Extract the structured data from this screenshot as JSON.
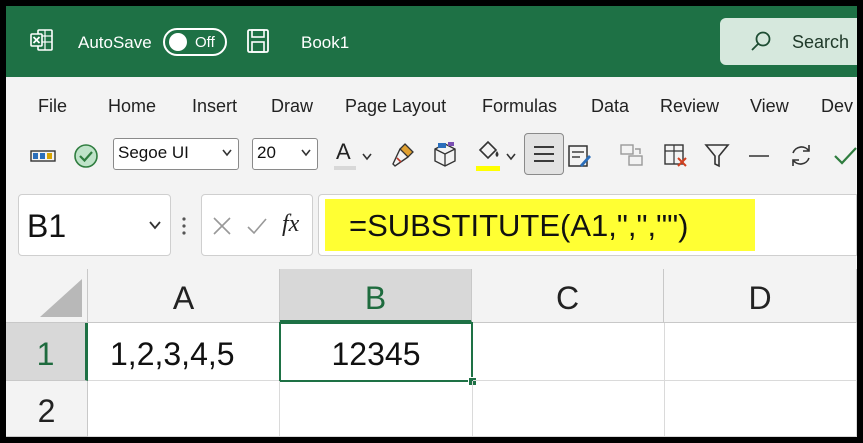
{
  "titlebar": {
    "autosave_label": "AutoSave",
    "autosave_state": "Off",
    "document_title": "Book1",
    "search_label": "Search"
  },
  "menu": {
    "items": [
      "File",
      "Home",
      "Insert",
      "Draw",
      "Page Layout",
      "Formulas",
      "Data",
      "Review",
      "View",
      "Dev"
    ]
  },
  "toolbar": {
    "font_name": "Segoe UI",
    "font_size": "20",
    "font_color_glyph": "A"
  },
  "formula_bar": {
    "name_box": "B1",
    "fx_label": "fx",
    "formula": "=SUBSTITUTE(A1,\",\",\"\")"
  },
  "sheet": {
    "columns": [
      "A",
      "B",
      "C",
      "D"
    ],
    "rows": [
      "1",
      "2"
    ],
    "cells": {
      "A1": "1,2,3,4,5",
      "B1": "12345"
    }
  },
  "colors": {
    "brand_green": "#1e7145",
    "formula_highlight": "#ffff33"
  },
  "icons": [
    "excel-icon",
    "save-icon",
    "search-icon",
    "cell-styles-icon",
    "accessibility-icon",
    "format-painter-icon",
    "3d-box-icon",
    "fill-color-icon",
    "align-center-icon",
    "form-icon",
    "merge-icon",
    "clear-format-icon",
    "filter-icon",
    "minus-icon",
    "refresh-icon",
    "checkmark-icon"
  ]
}
